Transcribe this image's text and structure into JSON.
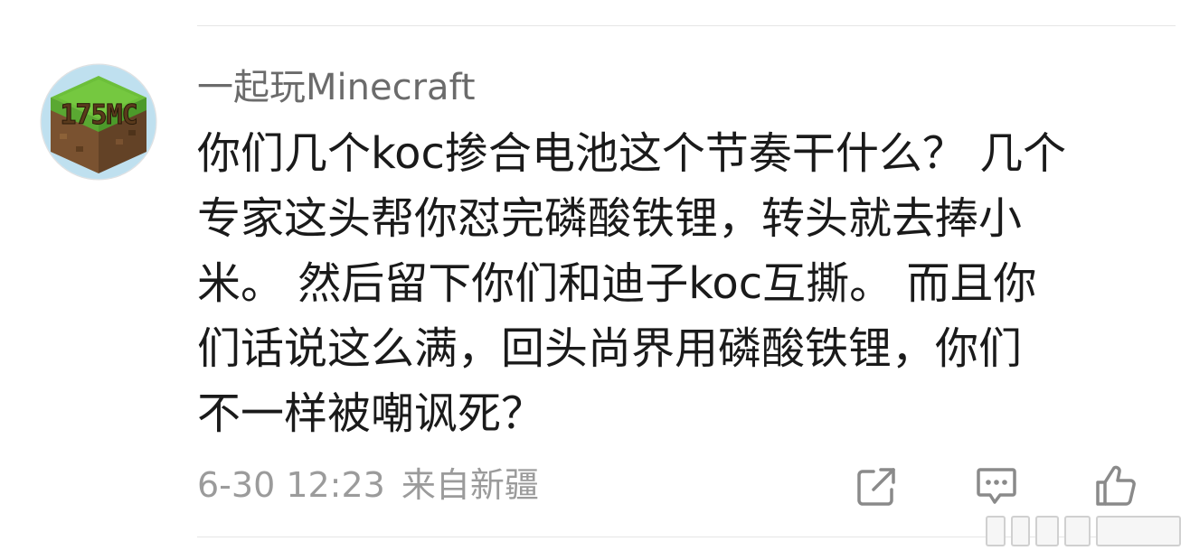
{
  "post": {
    "author": "一起玩Minecraft",
    "avatar_text": "175MC",
    "content_lines": [
      "你们几个koc掺合电池这个节奏干什么？ 几个",
      "专家这头帮你怼完磷酸铁锂，转头就去捧小",
      "米。 然后留下你们和迪子koc互撕。 而且你",
      "们话说这么满，回头尚界用磷酸铁锂，你们",
      "不一样被嘲讽死？"
    ],
    "timestamp": "6-30 12:23",
    "source": "来自新疆"
  },
  "actions": {
    "share_icon": "share-icon",
    "comment_icon": "comment-icon",
    "like_icon": "thumbs-up-icon"
  },
  "colors": {
    "author": "#6b6b6b",
    "text": "#1a1a1a",
    "meta": "#9b9b9b",
    "icon": "#8a8a8a"
  }
}
